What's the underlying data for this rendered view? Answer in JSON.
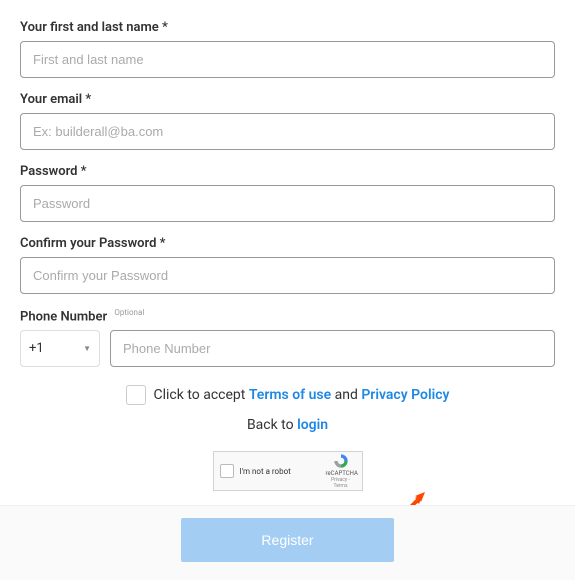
{
  "fields": {
    "name": {
      "label": "Your first and last name *",
      "placeholder": "First and last name"
    },
    "email": {
      "label": "Your email *",
      "placeholder": "Ex: builderall@ba.com"
    },
    "password": {
      "label": "Password *",
      "placeholder": "Password"
    },
    "confirm": {
      "label": "Confirm your Password *",
      "placeholder": "Confirm your Password"
    },
    "phone": {
      "label": "Phone Number",
      "optional": "Optional",
      "placeholder": "Phone Number",
      "country_code": "+1"
    }
  },
  "terms": {
    "prefix": "Click to accept ",
    "terms_link": "Terms of use",
    "and": " and ",
    "privacy_link": "Privacy Policy"
  },
  "back": {
    "text": "Back to ",
    "link": "login"
  },
  "recaptcha": {
    "label": "I'm not a robot",
    "brand": "reCAPTCHA",
    "sub": "Privacy - Terms"
  },
  "buttons": {
    "register": "Register"
  }
}
